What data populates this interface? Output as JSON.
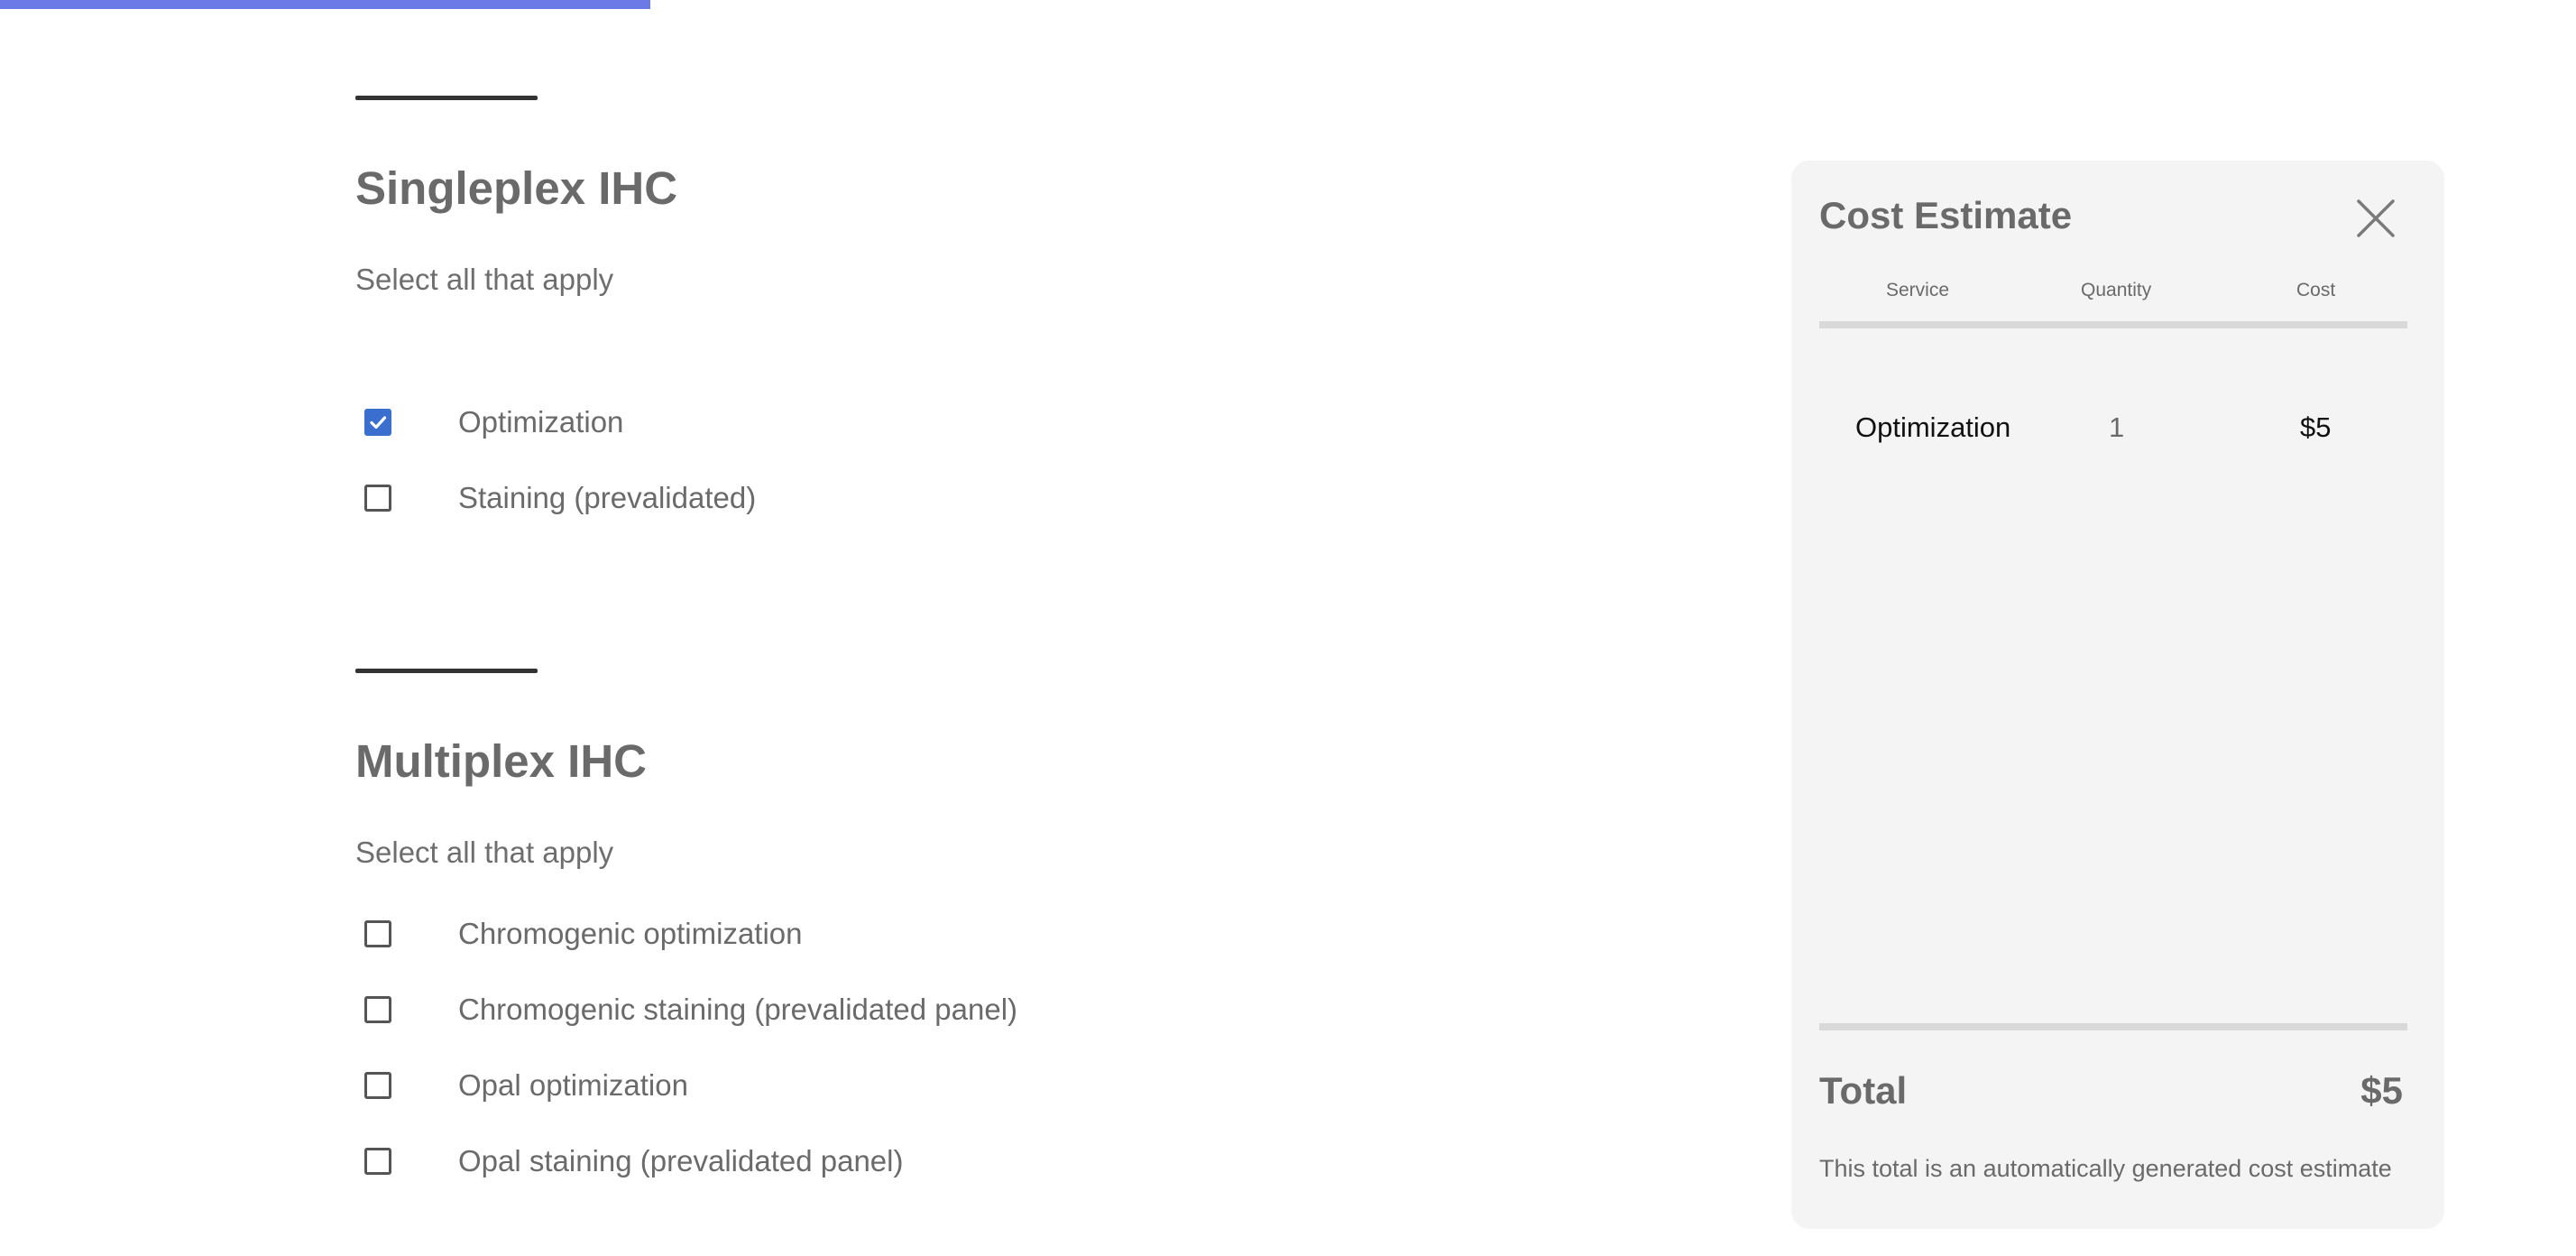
{
  "progress": {
    "fraction": 0.2525,
    "color": "#6b7ae6"
  },
  "sections": [
    {
      "title": "Singleplex IHC",
      "subtitle": "Select all that apply",
      "options": [
        {
          "label": "Optimization",
          "checked": true
        },
        {
          "label": "Staining (prevalidated)",
          "checked": false
        }
      ]
    },
    {
      "title": "Multiplex IHC",
      "subtitle": "Select all that apply",
      "options": [
        {
          "label": "Chromogenic optimization",
          "checked": false
        },
        {
          "label": "Chromogenic staining (prevalidated panel)",
          "checked": false
        },
        {
          "label": "Opal optimization",
          "checked": false
        },
        {
          "label": "Opal staining (prevalidated panel)",
          "checked": false
        }
      ]
    }
  ],
  "cost_panel": {
    "title": "Cost Estimate",
    "close_icon": "close-icon",
    "columns": [
      "Service",
      "Quantity",
      "Cost"
    ],
    "rows": [
      {
        "service": "Optimization",
        "quantity": "1",
        "cost": "$5"
      }
    ],
    "total_label": "Total",
    "total_value": "$5",
    "note": "This total is an automatically generated cost estimate"
  },
  "colors": {
    "accent": "#3b6fcf",
    "panel_bg": "#f4f4f4",
    "text_muted": "#6a6a6a"
  }
}
